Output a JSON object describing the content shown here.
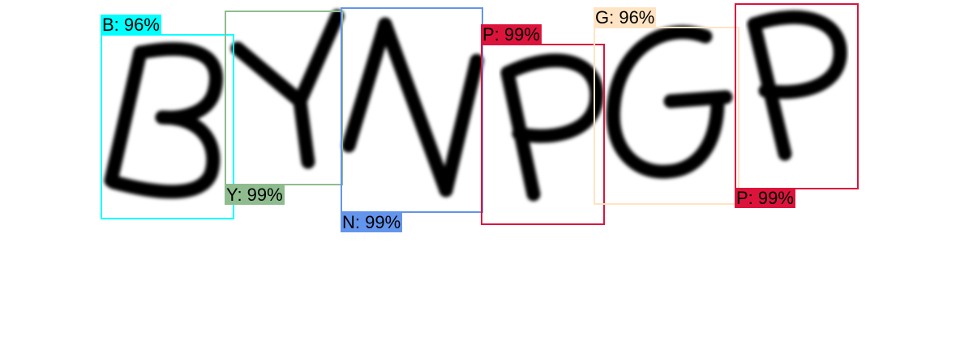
{
  "detections": [
    {
      "char": "B",
      "label": "B: 96%",
      "color": "#00ffff"
    },
    {
      "char": "Y",
      "label": "Y: 99%",
      "color": "#8fbc8f"
    },
    {
      "char": "N",
      "label": "N: 99%",
      "color": "#6495ed"
    },
    {
      "char": "P",
      "label": "P: 99%",
      "color": "#dc143c"
    },
    {
      "char": "G",
      "label": "G: 96%",
      "color": "#ffe4c4"
    },
    {
      "char": "P",
      "label": "P: 99%",
      "color": "#dc143c"
    }
  ]
}
